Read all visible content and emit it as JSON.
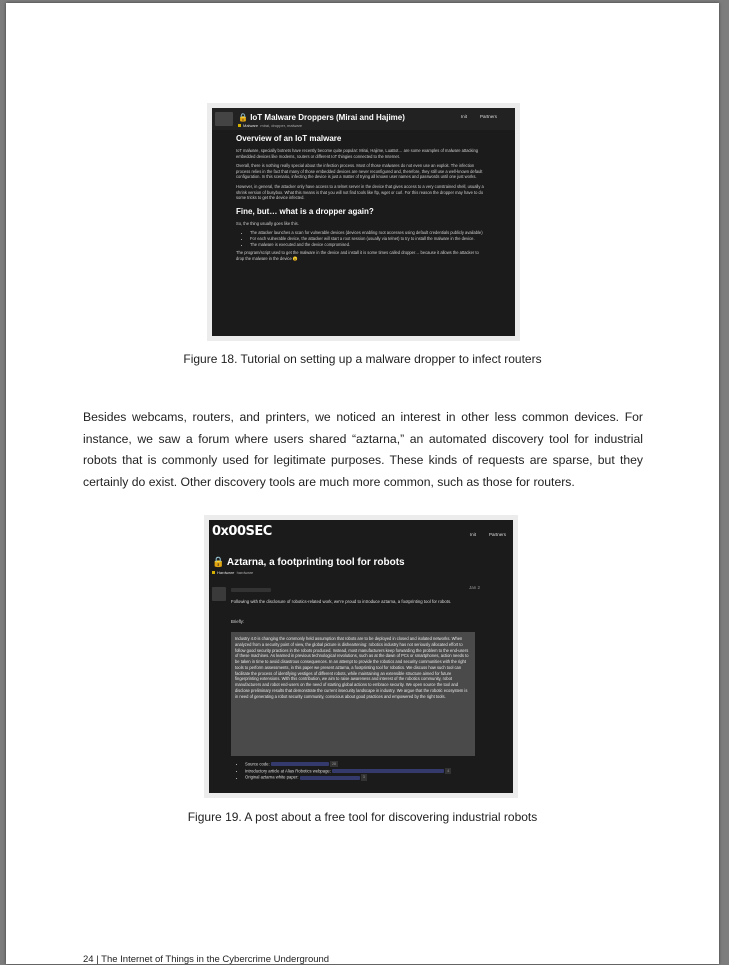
{
  "figure18": {
    "title": "IoT Malware Droppers (Mirai and Hajime)",
    "tags_label": "Malware",
    "tags": "mirai, dropper, malware",
    "nav": [
      "Init",
      "Partners"
    ],
    "heading1": "Overview of an IoT malware",
    "p1": "IoT malware, specially botnets have recently become quite popular: Mirai, Hajime, LuaBot… are some examples of malware attacking embedded devices like modems, routers or different IoT thingies connected to the Internet.",
    "p2": "Overall, there is nothing really special about the infection process. Most of those malwares do not even use an exploit. The infection process relies in the fact that many of those embedded devices are never reconfigured and, therefore, they still use a well-known default configuration. In this scenario, infecting the device is just a matter of trying all known user names and passwords until one just works.",
    "p3": "However, in general, the attacker only have access to a telnet server in the device that gives access to a very constrained shell, usually a shrink version of busybox. What this means is that you will not find tools like ftp, wget or curl. For this reason the dropper may have to do some tricks to get the device infected.",
    "heading2": "Fine, but… what is a dropper again?",
    "p4": "So, the thing usually goes like this.",
    "bullets": [
      "The attacker launches a scan for vulnerable devices (devices enabling root accesses using default credentials publicly available)",
      "For each vulnerable device, the attacker will start a root session (usually via telnet) to try to install the malware in the device.",
      "The malware is executed and the device compromised."
    ],
    "p5": "The program/script used to get the malware in the device and install it is some times called dropper… because it allows the attacker to drop the malware in the device 😉"
  },
  "caption18": "Figure 18. Tutorial on setting up a malware dropper to infect routers",
  "body_paragraph": "Besides webcams, routers, and printers, we noticed an interest in other less common devices. For instance, we saw a forum where users shared “aztarna,” an automated discovery tool for industrial robots that is commonly used for legitimate purposes. These kinds of requests are sparse, but they certainly do exist. Other discovery tools are much more common, such as those for routers.",
  "figure19": {
    "logo": "0x00SEC",
    "nav": [
      "Init",
      "Partners"
    ],
    "title": "Aztarna, a footprinting tool for robots",
    "tags_label": "Hardware",
    "tags": "hardware",
    "date": "Jan 2",
    "intro": "Following with the disclosure of robotics-related work, we're proud to introduce aztarna, a footprinting tool for robots.",
    "briefly": "Briefly:",
    "quote": "Industry 4.0 is changing the commonly held assumption that robots are to be deployed in closed and isolated networks. When analyzed from a security point of view, the global picture is disheartening: robotics industry has not seriously allocated effort to follow good security practices in the robots produced. Instead, most manufacturers keep forwarding the problem to the end-users of these machines. As learned in previous technological revolutions, such as at the dawn of PCs or smartphones, action needs to be taken in time to avoid disastrous consequences. In an attempt to provide the robotics and security communities with the right tools to perform assessments, in this paper we present aztarna, a footprinting tool for robotics. We discuss how such tool can facilitate the process of identifying vestiges of different robots, while maintaining an extensible structure aimed for future fingerprinting extensions. With this contribution, we aim to raise awareness and interest of the robotics community, robot manufacturers and robot end-users on the need of starting global actions to embrace security. We open source the tool and disclose preliminary results that demonstrate the current insecurity landscape in industry. We argue that the robotic ecosystem is in need of generating a robot security community, conscious about good practices and empowered by the right tools.",
    "links": [
      {
        "label": "Source code:",
        "count": "28"
      },
      {
        "label": "Introductory article at Alias Robotics webpage:",
        "count": "4"
      },
      {
        "label": "Original aztarna white paper:",
        "count": "3"
      }
    ]
  },
  "caption19": "Figure 19. A post about a free tool for discovering industrial robots",
  "footer": "24 | The Internet of Things in the Cybercrime Underground"
}
